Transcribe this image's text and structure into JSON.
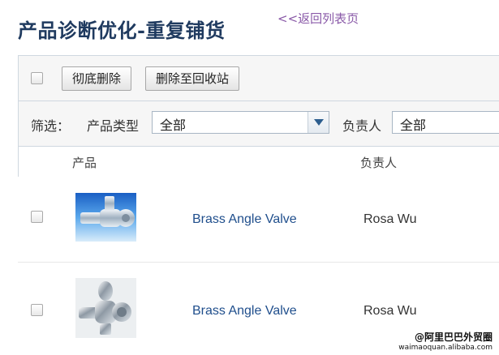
{
  "header": {
    "title": "产品诊断优化-重复铺货",
    "back_link": "<<返回列表页"
  },
  "toolbar": {
    "delete_permanently_label": "彻底删除",
    "delete_to_recycle_label": "删除至回收站"
  },
  "filter": {
    "label": "筛选：",
    "product_type_label": "产品类型",
    "product_type_value": "全部",
    "owner_label": "负责人",
    "owner_value": "全部"
  },
  "table": {
    "columns": [
      "产品",
      "负责人"
    ],
    "rows": [
      {
        "product_name": "Brass Angle Valve",
        "owner": "Rosa Wu",
        "image_icon": "blue-angle-valve-photo"
      },
      {
        "product_name": "Brass Angle Valve",
        "owner": "Rosa Wu",
        "image_icon": "chrome-angle-valve-photo"
      }
    ]
  },
  "watermark": {
    "line1": "@阿里巴巴外贸圈",
    "line2": "waimaoquan.alibaba.com"
  },
  "colors": {
    "title": "#1f3a5f",
    "link": "#8a5aa8",
    "product_link": "#1f4e8c",
    "panel_bg": "#f6f6f6",
    "border": "#cfd8e0"
  }
}
